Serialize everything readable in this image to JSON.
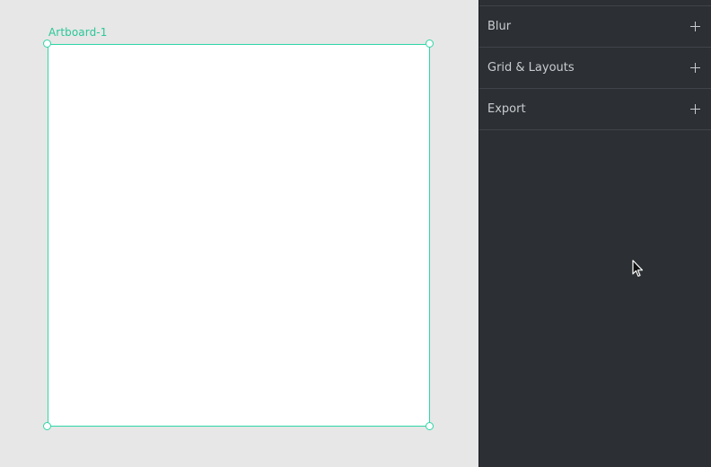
{
  "canvas": {
    "artboard_label": "Artboard-1",
    "accent_color": "#2fd6a6"
  },
  "panel": {
    "sections": [
      {
        "label": "Blur",
        "icon": "plus-icon"
      },
      {
        "label": "Grid & Layouts",
        "icon": "plus-icon"
      },
      {
        "label": "Export",
        "icon": "plus-icon"
      }
    ]
  }
}
